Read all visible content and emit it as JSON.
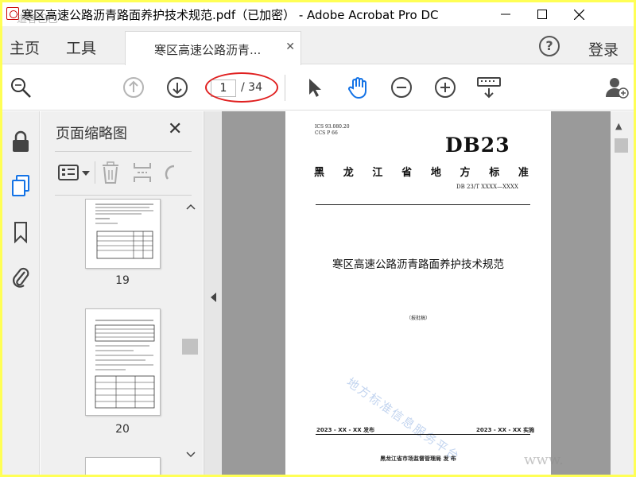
{
  "window": {
    "title": "寒区高速公路沥青路面养护技术规范.pdf（已加密） - Adobe Acrobat Pro DC",
    "overlay_watermark": "道客巴巴"
  },
  "menu": {
    "home": "主页",
    "tools": "工具",
    "doc_tab_label": "寒区高速公路沥青...",
    "help": "?",
    "login": "登录"
  },
  "toolbar": {
    "current_page": "1",
    "total_pages": "/ 34",
    "highlight_color": "#e02020",
    "accent_color": "#1473e6"
  },
  "thumbnail_panel": {
    "title": "页面缩略图",
    "close": "✕",
    "thumbnails": [
      {
        "number": "19"
      },
      {
        "number": "20"
      }
    ]
  },
  "document_page": {
    "ics_line1": "ICS  93.080.20",
    "ics_line2": "CCS  P 66",
    "db_code": "DB23",
    "standard_type_chars": [
      "黑",
      "龙",
      "江",
      "省",
      "地",
      "方",
      "标",
      "准"
    ],
    "standard_number": "DB 23/T  XXXX—XXXX",
    "doc_title": "寒区高速公路沥青路面养护技术规范",
    "draft_label": "（报批稿）",
    "publish_date": "2023 - XX - XX 发布",
    "implement_date": "2023 - XX - XX 实施",
    "issuer": "黑龙江省市场监督管理局      发  布",
    "watermark": "地方标准信息服务平台",
    "corner_watermark": "www."
  }
}
